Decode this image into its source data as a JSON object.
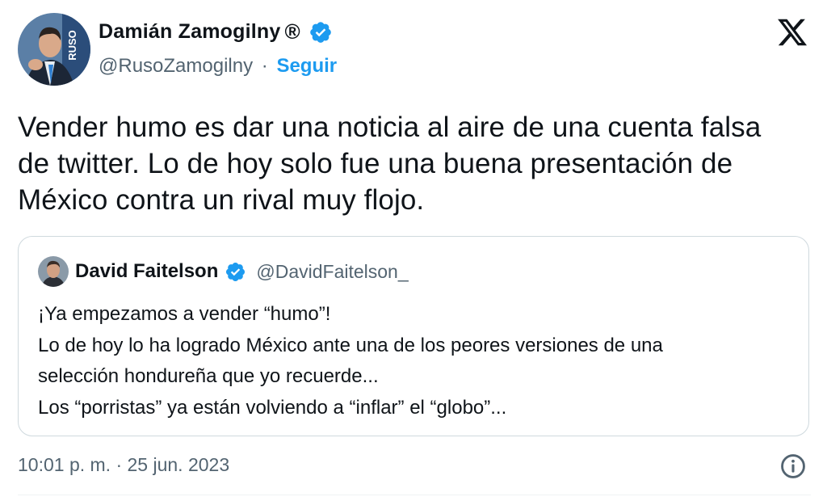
{
  "author": {
    "display_name": "Damián Zamogilny",
    "registered_mark": "®",
    "handle": "@RusoZamogilny",
    "separator": "·",
    "follow_label": "Seguir",
    "avatar_logo_text": "RUSO"
  },
  "tweet": {
    "text": "Vender humo es dar una noticia al aire de una cuenta falsa\nde twitter. Lo de hoy  solo fue una buena presentación de\nMéxico contra un rival muy flojo."
  },
  "quoted_tweet": {
    "display_name": "David Faitelson",
    "handle": "@DavidFaitelson_",
    "text": "¡Ya empezamos a vender “humo”!\nLo de hoy lo ha logrado México ante una de los peores versiones de una\nselección hondureña que yo recuerde...\nLos “porristas” ya están volviendo a “inflar” el “globo”..."
  },
  "footer": {
    "timestamp": "10:01 p. m. · 25 jun. 2023"
  },
  "icons": {
    "verified": "verified-badge-icon",
    "brand": "x-logo-icon",
    "info": "info-icon"
  },
  "colors": {
    "accent": "#1d9bf0",
    "text": "#0f1419",
    "secondary": "#536471",
    "border": "#cfd9de"
  }
}
